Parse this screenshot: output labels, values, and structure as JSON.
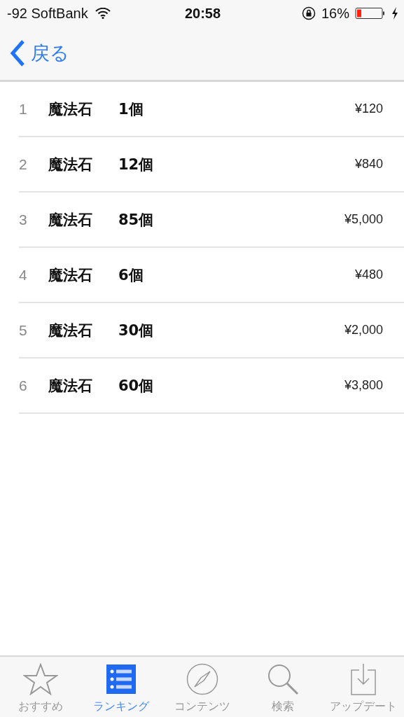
{
  "status_bar": {
    "signal": "-92 SoftBank",
    "time": "20:58",
    "battery": "16%"
  },
  "nav_bar": {
    "back_label": "戻る"
  },
  "items": [
    {
      "rank": "1",
      "name": "魔法石",
      "quantity": "1個",
      "price": "¥120"
    },
    {
      "rank": "2",
      "name": "魔法石",
      "quantity": "12個",
      "price": "¥840"
    },
    {
      "rank": "3",
      "name": "魔法石",
      "quantity": "85個",
      "price": "¥5,000"
    },
    {
      "rank": "4",
      "name": "魔法石",
      "quantity": "6個",
      "price": "¥480"
    },
    {
      "rank": "5",
      "name": "魔法石",
      "quantity": "30個",
      "price": "¥2,000"
    },
    {
      "rank": "6",
      "name": "魔法石",
      "quantity": "60個",
      "price": "¥3,800"
    }
  ],
  "tab_bar": [
    {
      "kind": "featured",
      "label": "おすすめ",
      "selected": false
    },
    {
      "kind": "ranking",
      "label": "ランキング",
      "selected": true
    },
    {
      "kind": "explore",
      "label": "コンテンツ",
      "selected": false
    },
    {
      "kind": "search",
      "label": "検索",
      "selected": false
    },
    {
      "kind": "updates",
      "label": "アップデート",
      "selected": false
    }
  ]
}
